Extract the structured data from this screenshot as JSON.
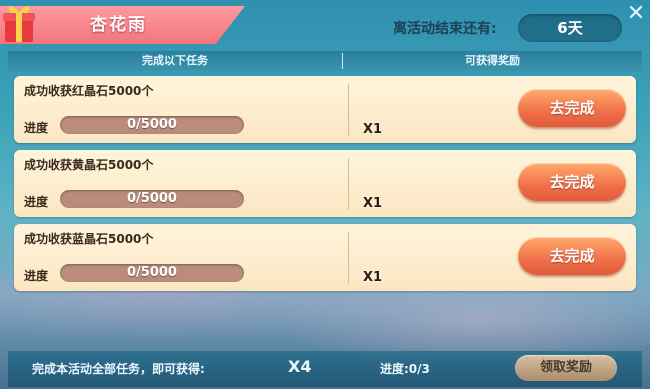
{
  "header": {
    "title": "杏花雨",
    "countdown_label": "离活动结束还有:",
    "countdown_value": "6天"
  },
  "columns": {
    "tasks": "完成以下任务",
    "rewards": "可获得奖励"
  },
  "tasks": [
    {
      "title": "成功收获红晶石5000个",
      "progress_label": "进度",
      "progress_text": "0/5000",
      "progress": 0,
      "reward_qty": "X1",
      "button": "去完成"
    },
    {
      "title": "成功收获黄晶石5000个",
      "progress_label": "进度",
      "progress_text": "0/5000",
      "progress": 0,
      "reward_qty": "X1",
      "button": "去完成"
    },
    {
      "title": "成功收获蓝晶石5000个",
      "progress_label": "进度",
      "progress_text": "0/5000",
      "progress": 0,
      "reward_qty": "X1",
      "button": "去完成"
    }
  ],
  "footer": {
    "summary": "完成本活动全部任务，即可获得:",
    "reward_qty": "X4",
    "progress": "进度:0/3",
    "claim_button": "领取奖励"
  },
  "colors": {
    "banner": "#f2767d",
    "card": "#fbe6c2",
    "button": "#f0704a",
    "progress_track": "#b98c7b"
  },
  "icons": {
    "gift": "gift-box-icon",
    "close": "close-icon"
  }
}
